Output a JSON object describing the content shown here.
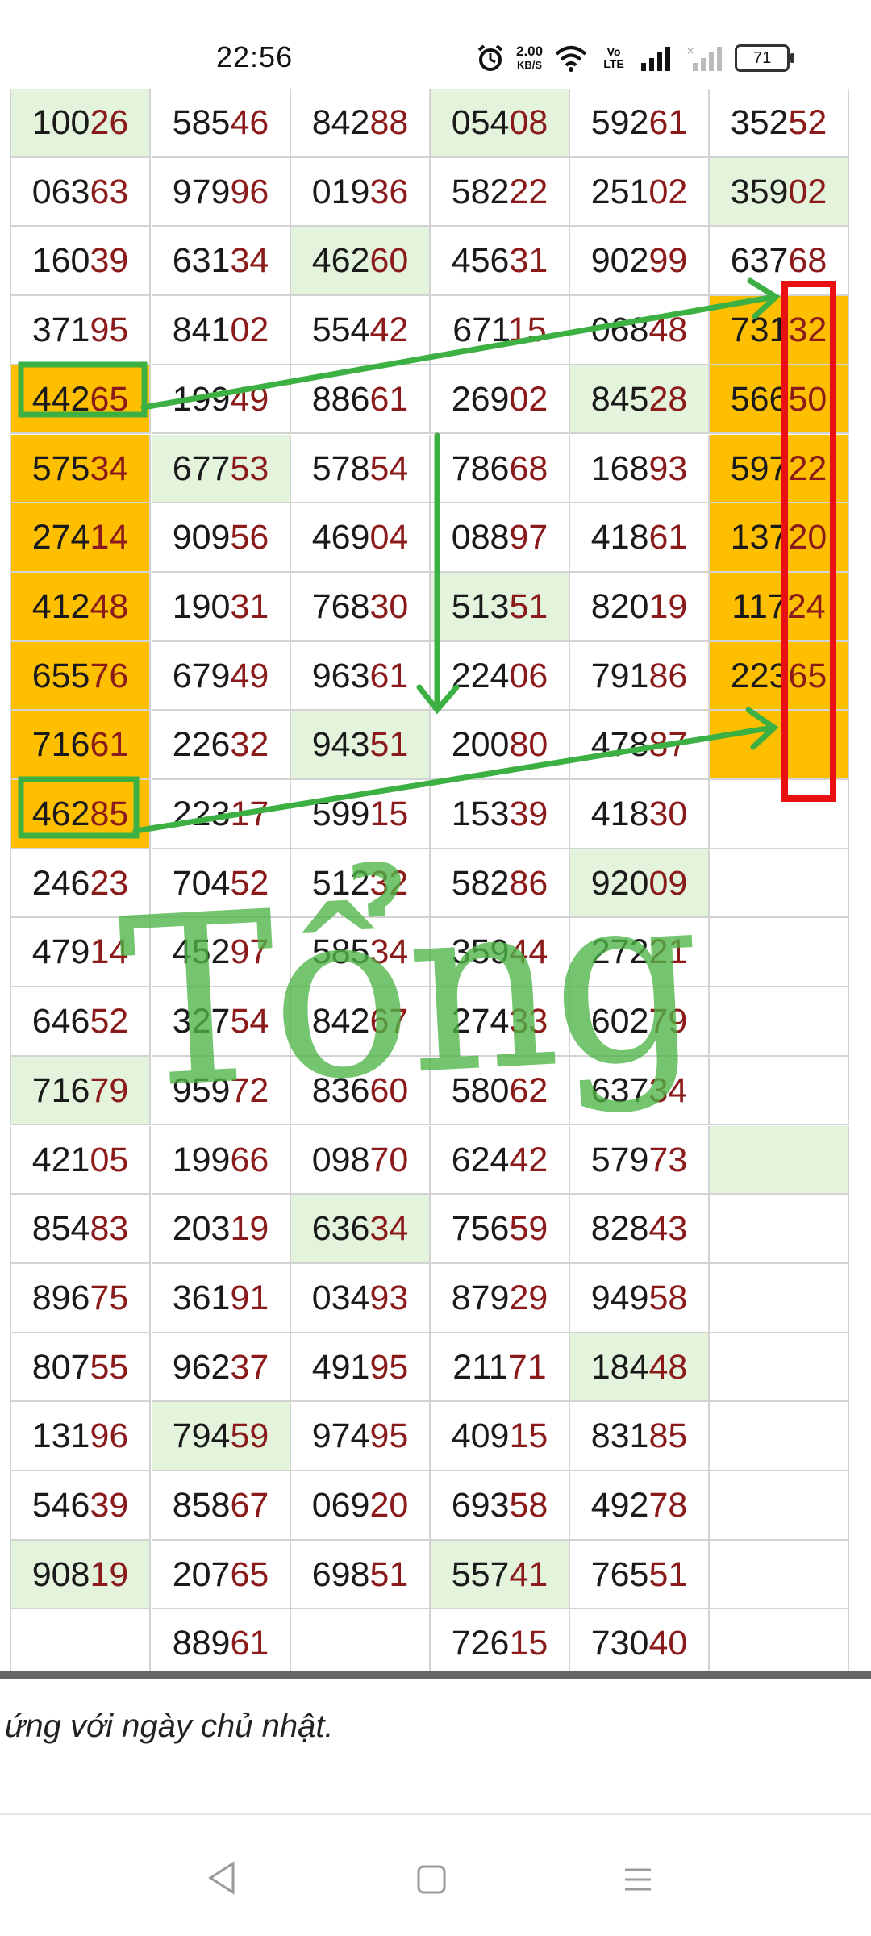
{
  "status_bar": {
    "time": "22:56",
    "speed_value": "2.00",
    "speed_unit": "KB/S",
    "volte": "Vo LTE",
    "battery": "71"
  },
  "table": {
    "rows": [
      [
        {
          "h": "100",
          "t": "26",
          "bg": "green"
        },
        {
          "h": "585",
          "t": "46"
        },
        {
          "h": "842",
          "t": "88"
        },
        {
          "h": "054",
          "t": "08",
          "bg": "green"
        },
        {
          "h": "592",
          "t": "61"
        },
        {
          "h": "352",
          "t": "52"
        }
      ],
      [
        {
          "h": "063",
          "t": "63"
        },
        {
          "h": "979",
          "t": "96"
        },
        {
          "h": "019",
          "t": "36"
        },
        {
          "h": "582",
          "t": "22"
        },
        {
          "h": "251",
          "t": "02"
        },
        {
          "h": "359",
          "t": "02",
          "bg": "green"
        }
      ],
      [
        {
          "h": "160",
          "t": "39"
        },
        {
          "h": "631",
          "t": "34"
        },
        {
          "h": "462",
          "t": "60",
          "bg": "green"
        },
        {
          "h": "456",
          "t": "31"
        },
        {
          "h": "902",
          "t": "99"
        },
        {
          "h": "637",
          "t": "68"
        }
      ],
      [
        {
          "h": "371",
          "t": "95"
        },
        {
          "h": "841",
          "t": "02"
        },
        {
          "h": "554",
          "t": "42"
        },
        {
          "h": "671",
          "t": "15"
        },
        {
          "h": "068",
          "t": "48"
        },
        {
          "h": "731",
          "t": "32",
          "bg": "orange"
        }
      ],
      [
        {
          "h": "442",
          "t": "65",
          "bg": "orange"
        },
        {
          "h": "199",
          "t": "49"
        },
        {
          "h": "886",
          "t": "61"
        },
        {
          "h": "269",
          "t": "02"
        },
        {
          "h": "845",
          "t": "28",
          "bg": "green"
        },
        {
          "h": "566",
          "t": "50",
          "bg": "orange"
        }
      ],
      [
        {
          "h": "575",
          "t": "34",
          "bg": "orange"
        },
        {
          "h": "677",
          "t": "53",
          "bg": "green"
        },
        {
          "h": "578",
          "t": "54"
        },
        {
          "h": "786",
          "t": "68"
        },
        {
          "h": "168",
          "t": "93"
        },
        {
          "h": "597",
          "t": "22",
          "bg": "orange"
        }
      ],
      [
        {
          "h": "274",
          "t": "14",
          "bg": "orange"
        },
        {
          "h": "909",
          "t": "56"
        },
        {
          "h": "469",
          "t": "04"
        },
        {
          "h": "088",
          "t": "97"
        },
        {
          "h": "418",
          "t": "61"
        },
        {
          "h": "137",
          "t": "20",
          "bg": "orange"
        }
      ],
      [
        {
          "h": "412",
          "t": "48",
          "bg": "orange"
        },
        {
          "h": "190",
          "t": "31"
        },
        {
          "h": "768",
          "t": "30"
        },
        {
          "h": "513",
          "t": "51",
          "bg": "green"
        },
        {
          "h": "820",
          "t": "19"
        },
        {
          "h": "117",
          "t": "24",
          "bg": "orange"
        }
      ],
      [
        {
          "h": "655",
          "t": "76",
          "bg": "orange"
        },
        {
          "h": "679",
          "t": "49"
        },
        {
          "h": "963",
          "t": "61"
        },
        {
          "h": "224",
          "t": "06"
        },
        {
          "h": "791",
          "t": "86"
        },
        {
          "h": "223",
          "t": "65",
          "bg": "orange"
        }
      ],
      [
        {
          "h": "716",
          "t": "61",
          "bg": "orange"
        },
        {
          "h": "226",
          "t": "32"
        },
        {
          "h": "943",
          "t": "51",
          "bg": "green"
        },
        {
          "h": "200",
          "t": "80"
        },
        {
          "h": "478",
          "t": "87"
        },
        {
          "h": "",
          "t": "",
          "bg": "orange"
        }
      ],
      [
        {
          "h": "462",
          "t": "85",
          "bg": "orange"
        },
        {
          "h": "223",
          "t": "17"
        },
        {
          "h": "599",
          "t": "15"
        },
        {
          "h": "153",
          "t": "39"
        },
        {
          "h": "418",
          "t": "30"
        },
        {
          "h": "",
          "t": ""
        }
      ],
      [
        {
          "h": "246",
          "t": "23"
        },
        {
          "h": "704",
          "t": "52"
        },
        {
          "h": "512",
          "t": "32"
        },
        {
          "h": "582",
          "t": "86"
        },
        {
          "h": "920",
          "t": "09",
          "bg": "green"
        },
        {
          "h": "",
          "t": ""
        }
      ],
      [
        {
          "h": "479",
          "t": "14"
        },
        {
          "h": "452",
          "t": "97"
        },
        {
          "h": "585",
          "t": "34"
        },
        {
          "h": "359",
          "t": "44"
        },
        {
          "h": "272",
          "t": "21"
        },
        {
          "h": "",
          "t": ""
        }
      ],
      [
        {
          "h": "646",
          "t": "52"
        },
        {
          "h": "327",
          "t": "54"
        },
        {
          "h": "842",
          "t": "67"
        },
        {
          "h": "274",
          "t": "33"
        },
        {
          "h": "602",
          "t": "79"
        },
        {
          "h": "",
          "t": ""
        }
      ],
      [
        {
          "h": "716",
          "t": "79",
          "bg": "green"
        },
        {
          "h": "959",
          "t": "72"
        },
        {
          "h": "836",
          "t": "60"
        },
        {
          "h": "580",
          "t": "62"
        },
        {
          "h": "637",
          "t": "34"
        },
        {
          "h": "",
          "t": ""
        }
      ],
      [
        {
          "h": "421",
          "t": "05"
        },
        {
          "h": "199",
          "t": "66"
        },
        {
          "h": "098",
          "t": "70"
        },
        {
          "h": "624",
          "t": "42"
        },
        {
          "h": "579",
          "t": "73"
        },
        {
          "h": "",
          "t": "",
          "bg": "green"
        }
      ],
      [
        {
          "h": "854",
          "t": "83"
        },
        {
          "h": "203",
          "t": "19"
        },
        {
          "h": "636",
          "t": "34",
          "bg": "green"
        },
        {
          "h": "756",
          "t": "59"
        },
        {
          "h": "828",
          "t": "43"
        },
        {
          "h": "",
          "t": ""
        }
      ],
      [
        {
          "h": "896",
          "t": "75"
        },
        {
          "h": "361",
          "t": "91"
        },
        {
          "h": "034",
          "t": "93"
        },
        {
          "h": "879",
          "t": "29"
        },
        {
          "h": "949",
          "t": "58"
        },
        {
          "h": "",
          "t": ""
        }
      ],
      [
        {
          "h": "807",
          "t": "55"
        },
        {
          "h": "962",
          "t": "37"
        },
        {
          "h": "491",
          "t": "95"
        },
        {
          "h": "211",
          "t": "71"
        },
        {
          "h": "184",
          "t": "48",
          "bg": "green"
        },
        {
          "h": "",
          "t": ""
        }
      ],
      [
        {
          "h": "131",
          "t": "96"
        },
        {
          "h": "794",
          "t": "59",
          "bg": "green"
        },
        {
          "h": "974",
          "t": "95"
        },
        {
          "h": "409",
          "t": "15"
        },
        {
          "h": "831",
          "t": "85"
        },
        {
          "h": "",
          "t": ""
        }
      ],
      [
        {
          "h": "546",
          "t": "39"
        },
        {
          "h": "858",
          "t": "67"
        },
        {
          "h": "069",
          "t": "20"
        },
        {
          "h": "693",
          "t": "58"
        },
        {
          "h": "492",
          "t": "78"
        },
        {
          "h": "",
          "t": ""
        }
      ],
      [
        {
          "h": "908",
          "t": "19",
          "bg": "green"
        },
        {
          "h": "207",
          "t": "65"
        },
        {
          "h": "698",
          "t": "51"
        },
        {
          "h": "557",
          "t": "41",
          "bg": "green"
        },
        {
          "h": "765",
          "t": "51"
        },
        {
          "h": "",
          "t": ""
        }
      ],
      [
        {
          "h": "",
          "t": ""
        },
        {
          "h": "889",
          "t": "61"
        },
        {
          "h": "",
          "t": ""
        },
        {
          "h": "726",
          "t": "15"
        },
        {
          "h": "730",
          "t": "40"
        },
        {
          "h": "",
          "t": ""
        }
      ]
    ]
  },
  "footnote": "ứng với ngày chủ nhật.",
  "annotation": {
    "handwritten_text": "Tổng",
    "color": "#3cb043",
    "red_box_color": "#e81010"
  },
  "colors": {
    "green_cell": "#e3f3dc",
    "orange_cell": "#fdbf00",
    "tail_digits": "#8b1a1a"
  },
  "nav": {
    "back": "◁",
    "home": "▢",
    "menu": "☰"
  }
}
